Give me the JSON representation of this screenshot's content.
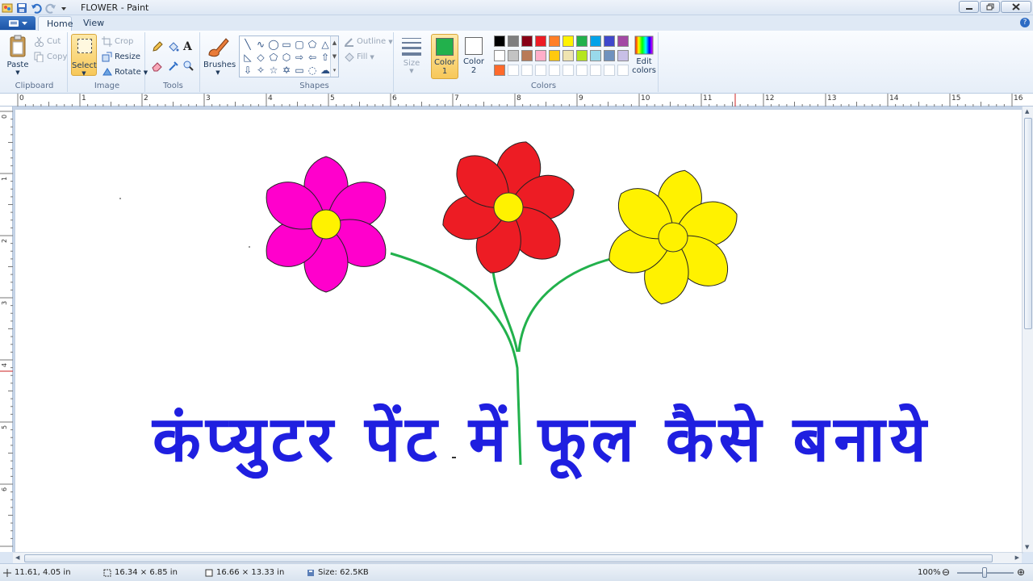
{
  "window": {
    "title": "FLOWER - Paint"
  },
  "tabs": [
    {
      "label": "Home"
    },
    {
      "label": "View"
    }
  ],
  "clipboard": {
    "paste": "Paste",
    "cut": "Cut",
    "copy": "Copy",
    "label": "Clipboard"
  },
  "image": {
    "select": "Select",
    "crop": "Crop",
    "resize": "Resize",
    "rotate": "Rotate",
    "label": "Image"
  },
  "tools": {
    "label": "Tools",
    "brushes": "Brushes"
  },
  "shapes": {
    "label": "Shapes",
    "outline": "Outline",
    "fill": "Fill"
  },
  "size": {
    "label": "Size"
  },
  "colors": {
    "label": "Colors",
    "color1_label": "Color\n1",
    "color1": "#22b14c",
    "color2_label": "Color\n2",
    "color2": "#ffffff",
    "edit": "Edit colors",
    "palette": [
      "#000000",
      "#7f7f7f",
      "#880015",
      "#ed1c24",
      "#ff7f27",
      "#fff200",
      "#22b14c",
      "#00a2e8",
      "#3f48cc",
      "#a349a4",
      "#ffffff",
      "#c3c3c3",
      "#b97a57",
      "#ffaec9",
      "#ffc90e",
      "#efe4b0",
      "#b5e61d",
      "#99d9ea",
      "#7092be",
      "#c8bfe7",
      "#ff6a2b",
      "",
      "",
      "",
      "",
      "",
      "",
      "",
      "",
      ""
    ]
  },
  "ruler": {
    "h": [
      "0",
      "1",
      "2",
      "3",
      "4",
      "5",
      "6",
      "7",
      "8",
      "9",
      "10",
      "11",
      "12",
      "13",
      "14",
      "15",
      "16"
    ],
    "v": [
      "0",
      "1",
      "2",
      "3",
      "4",
      "5",
      "6"
    ]
  },
  "canvas": {
    "caption": "कंप्युटर पेंट में फूल कैसे बनाये",
    "caption_color": "#1f1fe0",
    "flowers": [
      {
        "name": "pink",
        "petal": "#ff00cc",
        "center": "#fff200"
      },
      {
        "name": "red",
        "petal": "#ed1c24",
        "center": "#fff200"
      },
      {
        "name": "yellow",
        "petal": "#fff200",
        "center": "#fff200"
      }
    ],
    "stem_color": "#22b14c"
  },
  "status": {
    "cursor": "11.61, 4.05 in",
    "selection": "16.34 × 6.85 in",
    "canvas_size": "16.66 × 13.33 in",
    "file_size": "Size: 62.5KB",
    "zoom": "100%"
  }
}
